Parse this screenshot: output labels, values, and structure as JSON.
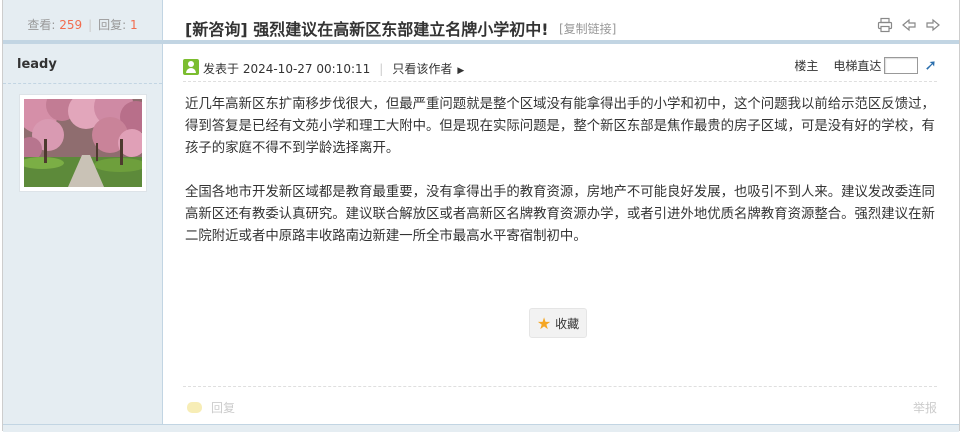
{
  "stats": {
    "views_label": "查看:",
    "views": "259",
    "replies_label": "回复:",
    "replies": "1"
  },
  "author": {
    "name": "leady"
  },
  "thread": {
    "title": "[新咨询] 强烈建议在高新区东部建立名牌小学初中!",
    "copy_link": "[复制链接]",
    "icons": [
      "print-icon",
      "prev-thread-icon",
      "next-thread-icon"
    ]
  },
  "meta": {
    "posted": "发表于 2024-10-27 00:10:11",
    "divider": "|",
    "author_only": "只看该作者",
    "floor": "楼主",
    "elevator": "电梯直达",
    "elevator_input": ""
  },
  "content": {
    "paragraphs": [
      "近几年高新区东扩南移步伐很大，但最严重问题就是整个区域没有能拿得出手的小学和初中，这个问题我以前给示范区反馈过，得到答复是已经有文苑小学和理工大附中。但是现在实际问题是，整个新区东部是焦作最贵的房子区域，可是没有好的学校，有孩子的家庭不得不到学龄选择离开。",
      "全国各地市开发新区域都是教育最重要，没有拿得出手的教育资源，房地产不可能良好发展，也吸引不到人来。建议发改委连同高新区还有教委认真研究。建议联合解放区或者高新区名牌教育资源办学，或者引进外地优质名牌教育资源整合。强烈建议在新二院附近或者中原路丰收路南边新建一所全市最高水平寄宿制初中。"
    ]
  },
  "actions": {
    "favorite": "收藏",
    "reply": "回复",
    "report": "举报"
  },
  "colors": {
    "accent": "#f26c4f",
    "side_bg": "#e5edf2",
    "border": "#c2d5e3"
  }
}
